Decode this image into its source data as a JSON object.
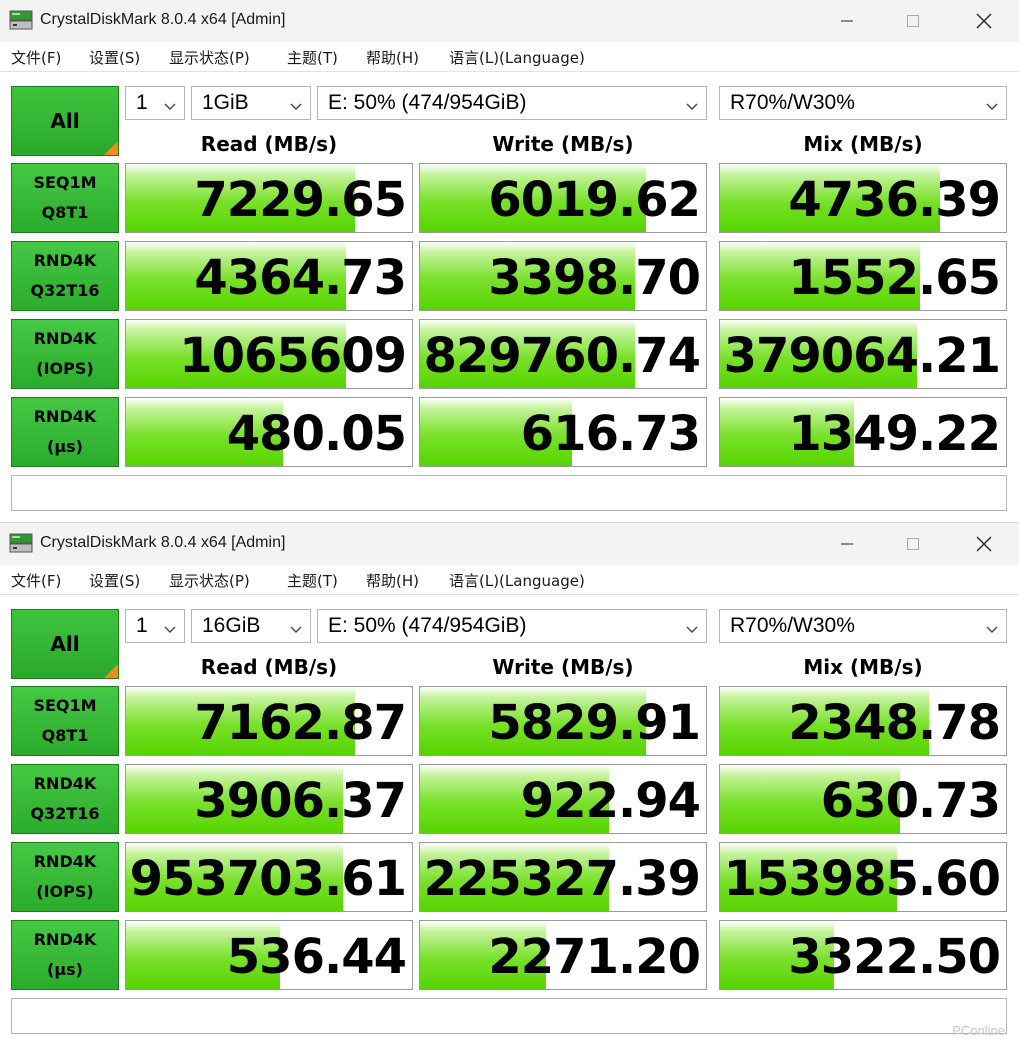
{
  "colors": {
    "accent_green": "#2aa82a",
    "bar_green": "#56d400",
    "corner_orange": "#f08c1e"
  },
  "windows": [
    {
      "title": "CrystalDiskMark 8.0.4 x64 [Admin]",
      "menu": [
        "文件(F)",
        "设置(S)",
        "显示状态(P)",
        "主题(T)",
        "帮助(H)",
        "语言(L)(Language)"
      ],
      "all_label": "All",
      "count": "1",
      "size": "1GiB",
      "drive": "E: 50% (474/954GiB)",
      "mix_ratio": "R70%/W30%",
      "headers": {
        "read": "Read (MB/s)",
        "write": "Write (MB/s)",
        "mix": "Mix (MB/s)"
      },
      "rows": [
        {
          "l1": "SEQ1M",
          "l2": "Q8T1",
          "read": "7229.65",
          "write": "6019.62",
          "mix": "4736.39",
          "read_fill": 0.8,
          "write_fill": 0.79,
          "mix_fill": 0.77
        },
        {
          "l1": "RND4K",
          "l2": "Q32T16",
          "read": "4364.73",
          "write": "3398.70",
          "mix": "1552.65",
          "read_fill": 0.77,
          "write_fill": 0.75,
          "mix_fill": 0.7
        },
        {
          "l1": "RND4K",
          "l2": "(IOPS)",
          "read": "1065609",
          "write": "829760.74",
          "mix": "379064.21",
          "read_fill": 0.77,
          "write_fill": 0.75,
          "mix_fill": 0.69
        },
        {
          "l1": "RND4K",
          "l2": "(µs)",
          "read": "480.05",
          "write": "616.73",
          "mix": "1349.22",
          "read_fill": 0.55,
          "write_fill": 0.53,
          "mix_fill": 0.47
        }
      ]
    },
    {
      "title": "CrystalDiskMark 8.0.4 x64 [Admin]",
      "menu": [
        "文件(F)",
        "设置(S)",
        "显示状态(P)",
        "主题(T)",
        "帮助(H)",
        "语言(L)(Language)"
      ],
      "all_label": "All",
      "count": "1",
      "size": "16GiB",
      "drive": "E: 50% (474/954GiB)",
      "mix_ratio": "R70%/W30%",
      "headers": {
        "read": "Read (MB/s)",
        "write": "Write (MB/s)",
        "mix": "Mix (MB/s)"
      },
      "rows": [
        {
          "l1": "SEQ1M",
          "l2": "Q8T1",
          "read": "7162.87",
          "write": "5829.91",
          "mix": "2348.78",
          "read_fill": 0.8,
          "write_fill": 0.79,
          "mix_fill": 0.73
        },
        {
          "l1": "RND4K",
          "l2": "Q32T16",
          "read": "3906.37",
          "write": "922.94",
          "mix": "630.73",
          "read_fill": 0.76,
          "write_fill": 0.66,
          "mix_fill": 0.63
        },
        {
          "l1": "RND4K",
          "l2": "(IOPS)",
          "read": "953703.61",
          "write": "225327.39",
          "mix": "153985.60",
          "read_fill": 0.76,
          "write_fill": 0.66,
          "mix_fill": 0.62
        },
        {
          "l1": "RND4K",
          "l2": "(µs)",
          "read": "536.44",
          "write": "2271.20",
          "mix": "3322.50",
          "read_fill": 0.54,
          "write_fill": 0.44,
          "mix_fill": 0.4
        }
      ]
    }
  ],
  "watermark": "PConline"
}
